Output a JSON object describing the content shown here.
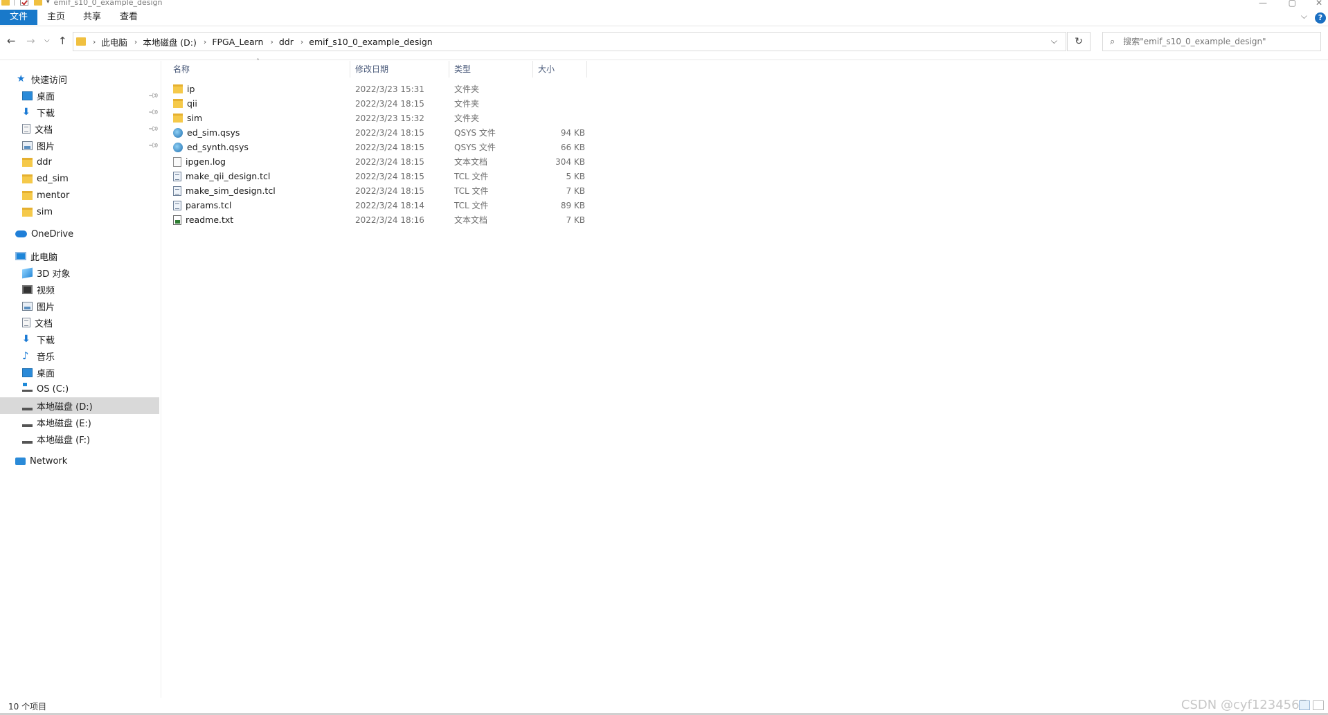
{
  "window": {
    "title": "emif_s10_0_example_design",
    "minimize": "—",
    "maximize": "▢",
    "close": "✕"
  },
  "ribbon": {
    "tabs": [
      {
        "label": "文件",
        "active": true
      },
      {
        "label": "主页",
        "active": false
      },
      {
        "label": "共享",
        "active": false
      },
      {
        "label": "查看",
        "active": false
      }
    ],
    "help": "?"
  },
  "nav": {
    "breadcrumbs": [
      "此电脑",
      "本地磁盘 (D:)",
      "FPGA_Learn",
      "ddr",
      "emif_s10_0_example_design"
    ],
    "search_placeholder": "搜索\"emif_s10_0_example_design\""
  },
  "sidebar": {
    "quick_access": {
      "label": "快速访问",
      "items": [
        {
          "label": "桌面",
          "icon": "desktop-icon",
          "pinned": true
        },
        {
          "label": "下载",
          "icon": "download-icon",
          "pinned": true
        },
        {
          "label": "文档",
          "icon": "document-icon",
          "pinned": true
        },
        {
          "label": "图片",
          "icon": "picture-icon",
          "pinned": true
        },
        {
          "label": "ddr",
          "icon": "folder-icon",
          "pinned": false
        },
        {
          "label": "ed_sim",
          "icon": "folder-icon",
          "pinned": false
        },
        {
          "label": "mentor",
          "icon": "folder-icon",
          "pinned": false
        },
        {
          "label": "sim",
          "icon": "folder-icon",
          "pinned": false
        }
      ]
    },
    "onedrive": "OneDrive",
    "this_pc": {
      "label": "此电脑",
      "items": [
        {
          "label": "3D 对象",
          "icon": "3d-objects-icon"
        },
        {
          "label": "视频",
          "icon": "video-icon"
        },
        {
          "label": "图片",
          "icon": "picture-icon"
        },
        {
          "label": "文档",
          "icon": "document-icon"
        },
        {
          "label": "下载",
          "icon": "download-icon"
        },
        {
          "label": "音乐",
          "icon": "music-icon"
        },
        {
          "label": "桌面",
          "icon": "desktop-icon"
        },
        {
          "label": "OS (C:)",
          "icon": "os-drive-icon"
        },
        {
          "label": "本地磁盘 (D:)",
          "icon": "drive-icon",
          "selected": true
        },
        {
          "label": "本地磁盘 (E:)",
          "icon": "drive-icon"
        },
        {
          "label": "本地磁盘 (F:)",
          "icon": "drive-icon"
        }
      ]
    },
    "network": "Network"
  },
  "columns": {
    "name": "名称",
    "date": "修改日期",
    "type": "类型",
    "size": "大小"
  },
  "files": [
    {
      "name": "ip",
      "date": "2022/3/23 15:31",
      "type": "文件夹",
      "size": "",
      "icon": "folder"
    },
    {
      "name": "qii",
      "date": "2022/3/24 18:15",
      "type": "文件夹",
      "size": "",
      "icon": "folder"
    },
    {
      "name": "sim",
      "date": "2022/3/23 15:32",
      "type": "文件夹",
      "size": "",
      "icon": "folder"
    },
    {
      "name": "ed_sim.qsys",
      "date": "2022/3/24 18:15",
      "type": "QSYS 文件",
      "size": "94 KB",
      "icon": "qsys"
    },
    {
      "name": "ed_synth.qsys",
      "date": "2022/3/24 18:15",
      "type": "QSYS 文件",
      "size": "66 KB",
      "icon": "qsys"
    },
    {
      "name": "ipgen.log",
      "date": "2022/3/24 18:15",
      "type": "文本文档",
      "size": "304 KB",
      "icon": "log"
    },
    {
      "name": "make_qii_design.tcl",
      "date": "2022/3/24 18:15",
      "type": "TCL 文件",
      "size": "5 KB",
      "icon": "tcl"
    },
    {
      "name": "make_sim_design.tcl",
      "date": "2022/3/24 18:15",
      "type": "TCL 文件",
      "size": "7 KB",
      "icon": "tcl"
    },
    {
      "name": "params.tcl",
      "date": "2022/3/24 18:14",
      "type": "TCL 文件",
      "size": "89 KB",
      "icon": "tcl"
    },
    {
      "name": "readme.txt",
      "date": "2022/3/24 18:16",
      "type": "文本文档",
      "size": "7 KB",
      "icon": "txt"
    }
  ],
  "status": {
    "count": "10 个项目",
    "watermark": "CSDN @cyf1234567"
  }
}
